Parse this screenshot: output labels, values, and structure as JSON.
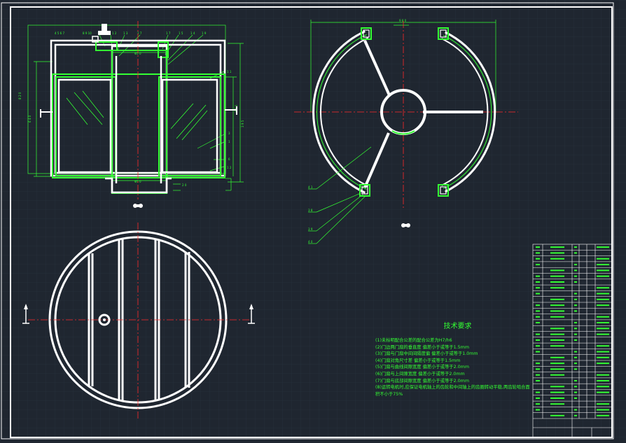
{
  "drawing": {
    "colors": {
      "background": "#1f2630",
      "grid": "#2a3440",
      "outline": "#ffffff",
      "dimension": "#33ff33",
      "centerline": "#ff2a2a"
    }
  },
  "technical_requirements": {
    "title": "技术要求",
    "items": [
      "(1)未标明配合公差的配合公差为H7/h6",
      "(2)门边两门扇的垂直度 偏差小于或等于1.5mm",
      "(3)门扇与门扇中间间隔度偏 偏差小于或等于1.0mm",
      "(4)门扇对角尺寸差 偏差小于或等于1.5mm",
      "(5)门扇与曲线间隙宽度 偏差小于或等于2.0mm",
      "(6)门扇与上间隙宽度 偏差小于或等于2.0mm",
      "(7)门扇与底部间隙宽度 偏差小于或等于2.0mm",
      "(8)运转电机时,应保证电机轴上的齿轮和中间轴上的齿圈转动平稳,两齿轮啮合面积不小于75%"
    ]
  }
}
